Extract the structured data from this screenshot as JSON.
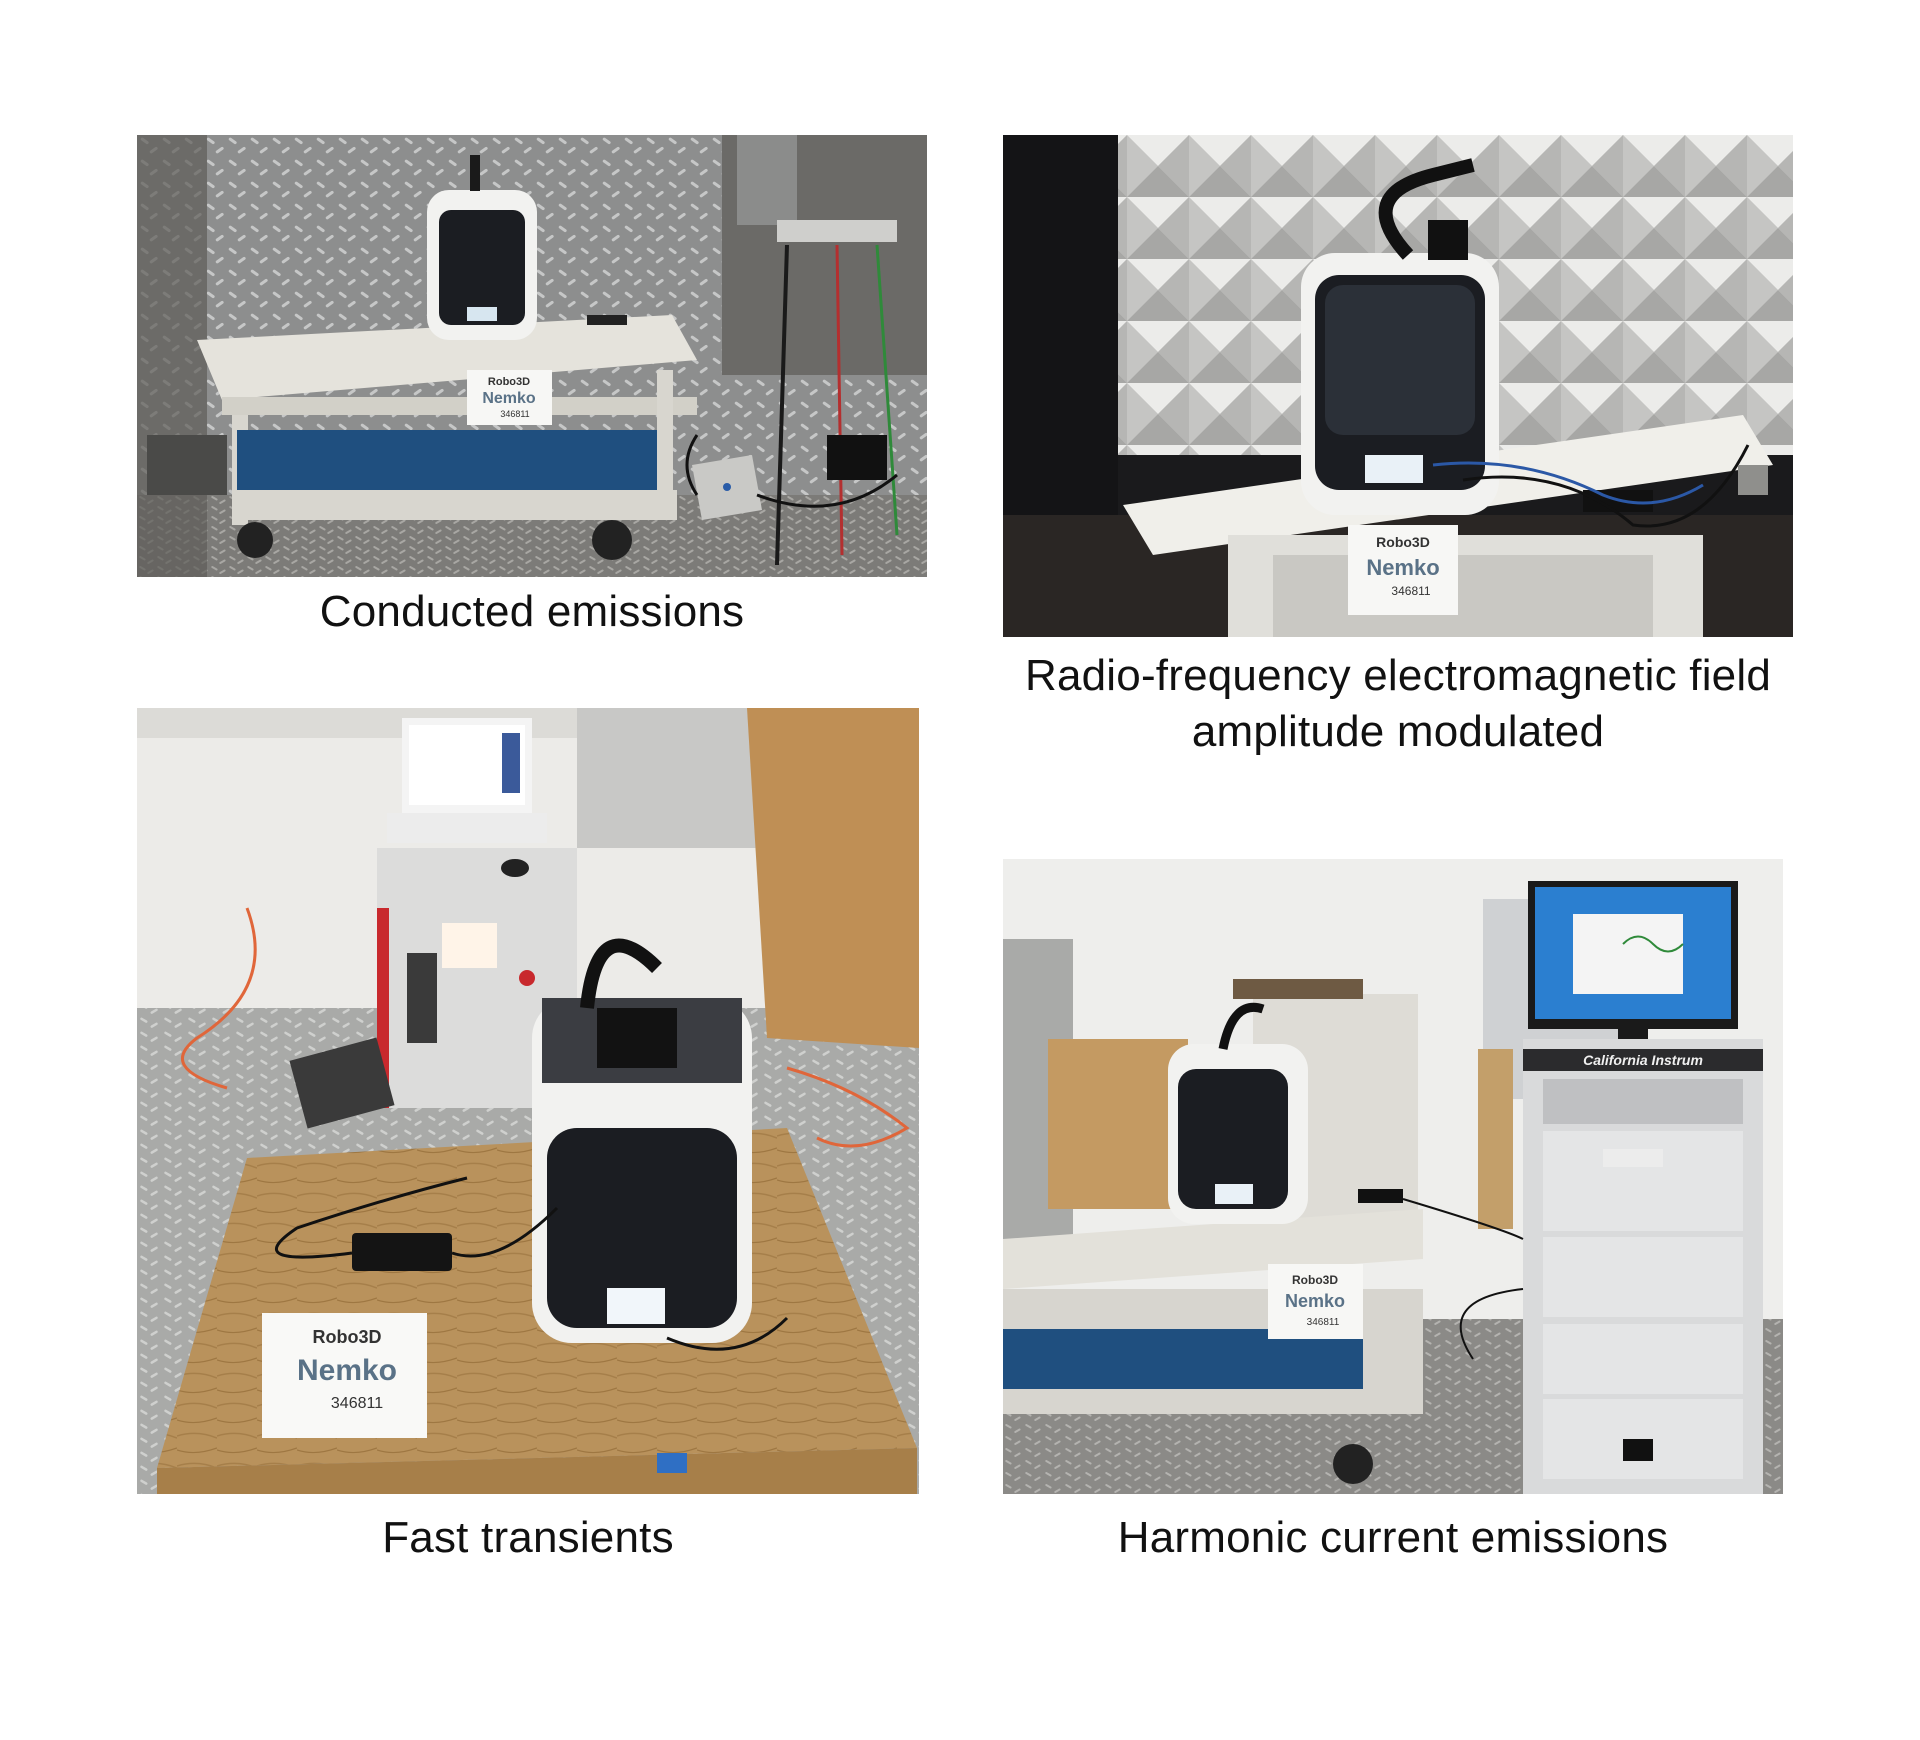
{
  "figures": [
    {
      "id": "conducted",
      "caption": "Conducted emissions",
      "label_sign": {
        "brand": "Robo3D",
        "logo": "Nemko",
        "number": "346811"
      }
    },
    {
      "id": "rf",
      "caption_lines": [
        "Radio-frequency electromagnetic field",
        "amplitude modulated"
      ],
      "label_sign": {
        "brand": "Robo3D",
        "logo": "Nemko",
        "number": "346811"
      }
    },
    {
      "id": "fast",
      "caption": "Fast transients",
      "label_sign": {
        "brand": "Robo3D",
        "logo": "Nemko",
        "number": "346811"
      }
    },
    {
      "id": "harmonic",
      "caption": "Harmonic current emissions",
      "label_sign": {
        "brand": "Robo3D",
        "logo": "Nemko",
        "number": "346811"
      },
      "rack_label": "California Instrum"
    }
  ],
  "colors": {
    "printer_body": "#f2f2f0",
    "printer_window": "#1b1d22",
    "table_white": "#e7e6e1",
    "mat_blue": "#1f4f7f",
    "plywood": "#b9925c",
    "chamber_foam": "#dcdcda",
    "floor_metal": "#9a9a98",
    "amp_red": "#c8292d"
  }
}
